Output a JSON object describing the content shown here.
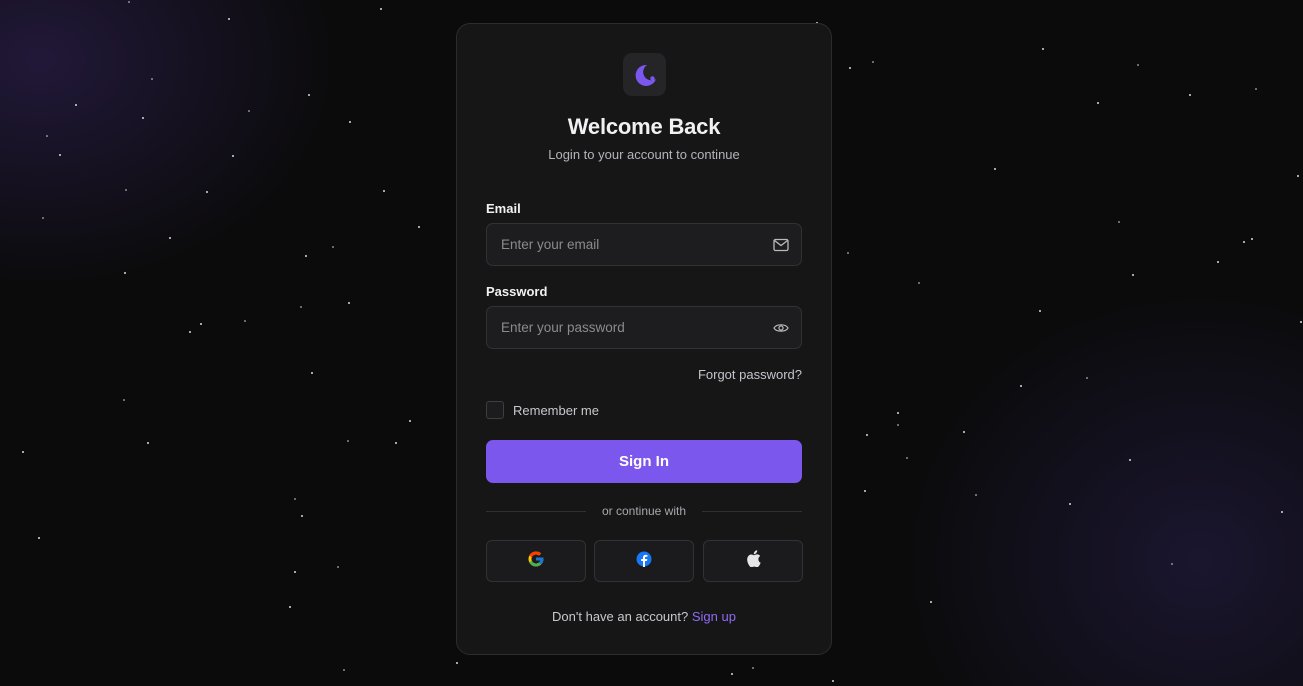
{
  "header": {
    "title": "Welcome Back",
    "subtitle": "Login to your account to continue"
  },
  "form": {
    "email_label": "Email",
    "email_placeholder": "Enter your email",
    "email_value": "",
    "password_label": "Password",
    "password_placeholder": "Enter your password",
    "password_value": "",
    "forgot_label": "Forgot password?",
    "remember_label": "Remember me",
    "remember_checked": false,
    "submit_label": "Sign In"
  },
  "social": {
    "divider_text": "or continue with",
    "providers": [
      {
        "name": "google",
        "icon": "google-icon"
      },
      {
        "name": "facebook",
        "icon": "facebook-icon"
      },
      {
        "name": "apple",
        "icon": "apple-icon"
      }
    ]
  },
  "footer": {
    "prompt": "Don't have an account?",
    "link_label": "Sign up"
  },
  "colors": {
    "accent": "#7c57ee",
    "link": "#8f6bf6",
    "card_bg": "#161617",
    "page_bg": "#0b0b0c"
  },
  "icons": {
    "logo": "moon-logo-icon",
    "email": "mail-icon",
    "password": "eye-icon"
  }
}
